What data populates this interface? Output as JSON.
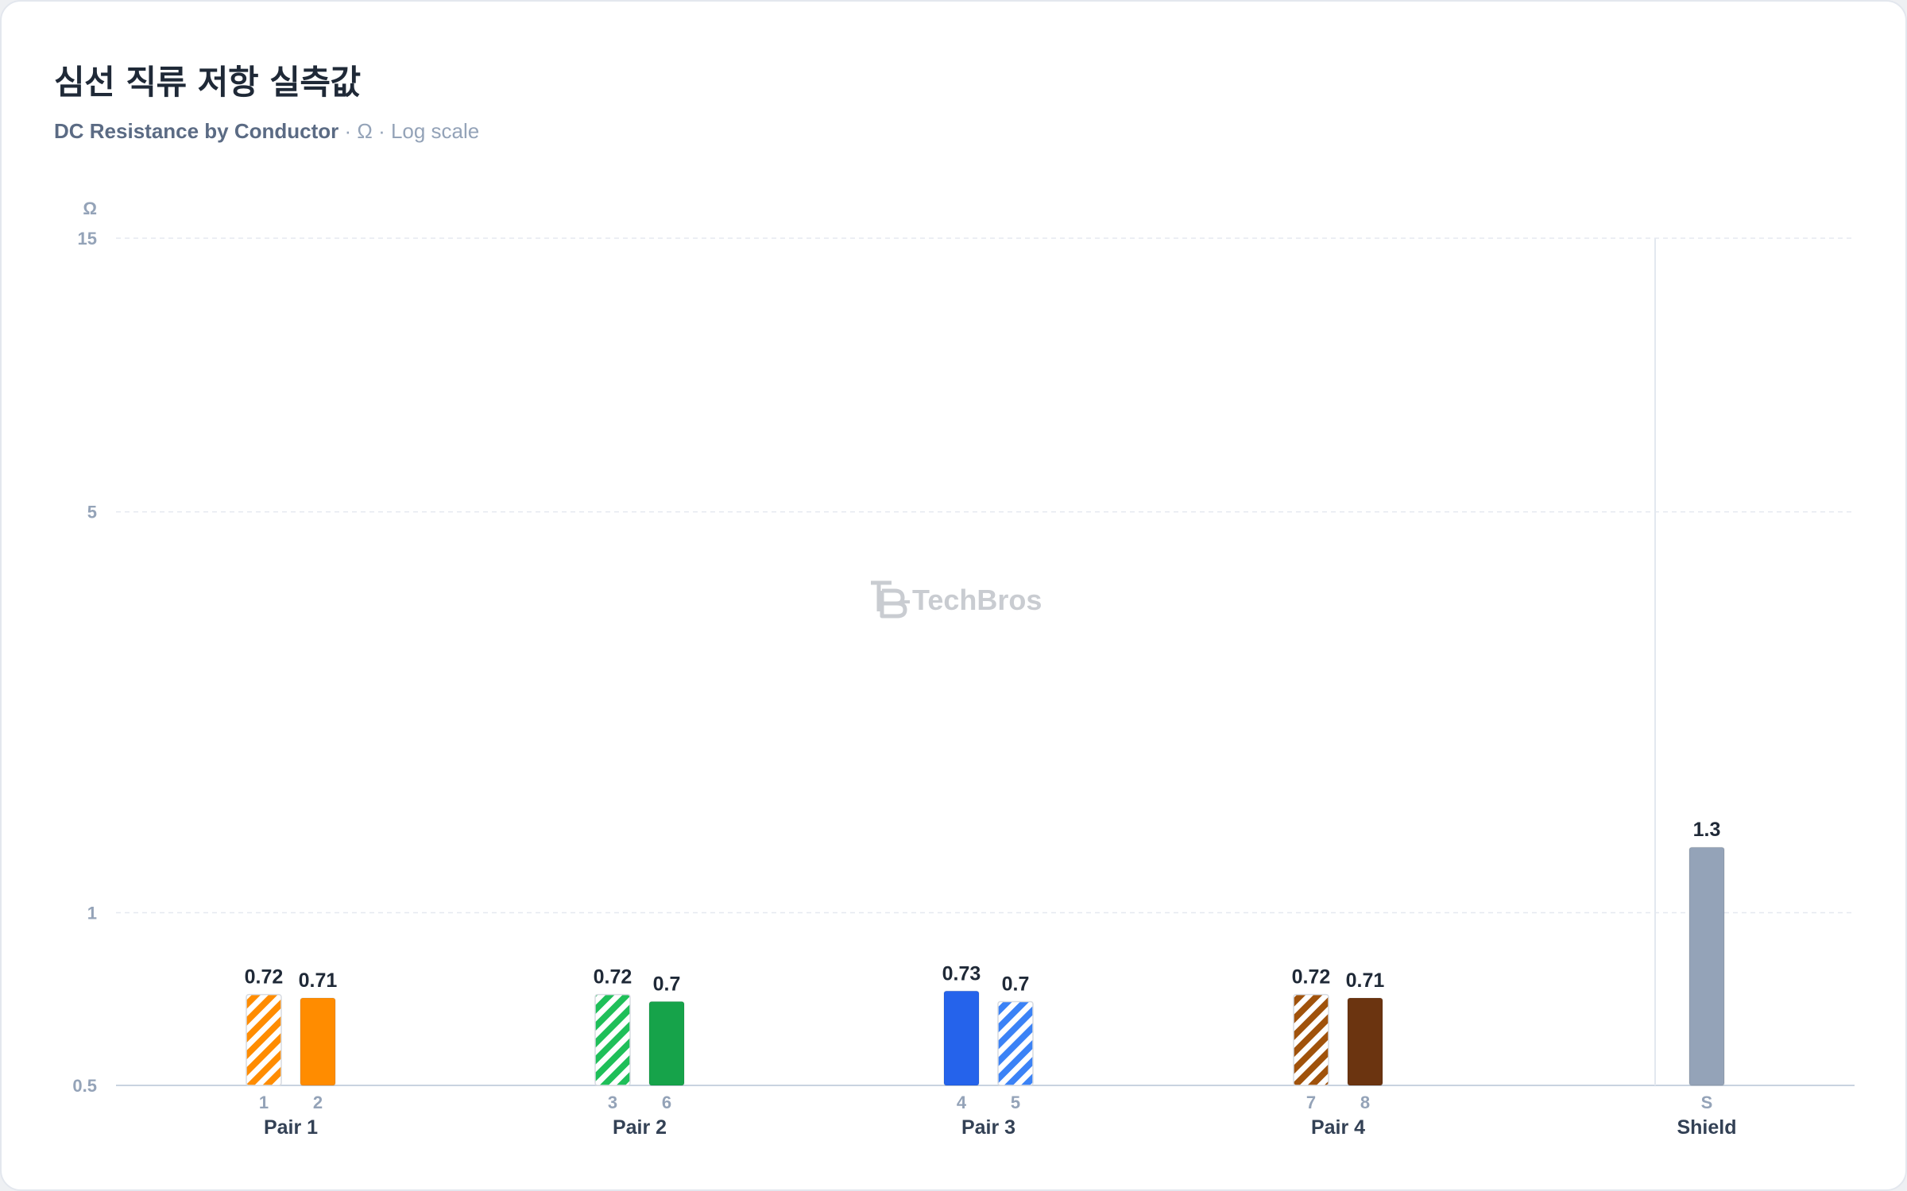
{
  "header": {
    "title": "심선 직류 저항 실측값",
    "subtitle_main": "DC Resistance by Conductor",
    "subtitle_rest": " · Ω · Log scale"
  },
  "watermark": {
    "text": "TechBros"
  },
  "chart_data": {
    "type": "bar",
    "y_unit_label": "Ω",
    "y_scale": "log",
    "ylim": [
      0.5,
      15
    ],
    "y_ticks": [
      {
        "value": 0.5,
        "label": "0.5"
      },
      {
        "value": 1,
        "label": "1"
      },
      {
        "value": 5,
        "label": "5"
      },
      {
        "value": 15,
        "label": "15"
      }
    ],
    "grid": true,
    "groups": [
      {
        "name": "Pair 1",
        "bars": [
          {
            "label": "1",
            "value": 0.72,
            "value_label": "0.72",
            "color": "#ff8c00",
            "striped": true
          },
          {
            "label": "2",
            "value": 0.71,
            "value_label": "0.71",
            "color": "#ff8c00",
            "striped": false
          }
        ]
      },
      {
        "name": "Pair 2",
        "bars": [
          {
            "label": "3",
            "value": 0.72,
            "value_label": "0.72",
            "color": "#1fbf59",
            "striped": true
          },
          {
            "label": "6",
            "value": 0.7,
            "value_label": "0.7",
            "color": "#16a34a",
            "striped": false
          }
        ]
      },
      {
        "name": "Pair 3",
        "bars": [
          {
            "label": "4",
            "value": 0.73,
            "value_label": "0.73",
            "color": "#2563eb",
            "striped": false
          },
          {
            "label": "5",
            "value": 0.7,
            "value_label": "0.7",
            "color": "#3b82f6",
            "striped": true
          }
        ]
      },
      {
        "name": "Pair 4",
        "bars": [
          {
            "label": "7",
            "value": 0.72,
            "value_label": "0.72",
            "color": "#a0520b",
            "striped": true
          },
          {
            "label": "8",
            "value": 0.71,
            "value_label": "0.71",
            "color": "#6b3410",
            "striped": false
          }
        ]
      },
      {
        "name": "Shield",
        "bars": [
          {
            "label": "S",
            "value": 1.3,
            "value_label": "1.3",
            "color": "#94a3b8",
            "striped": false
          }
        ]
      }
    ]
  }
}
